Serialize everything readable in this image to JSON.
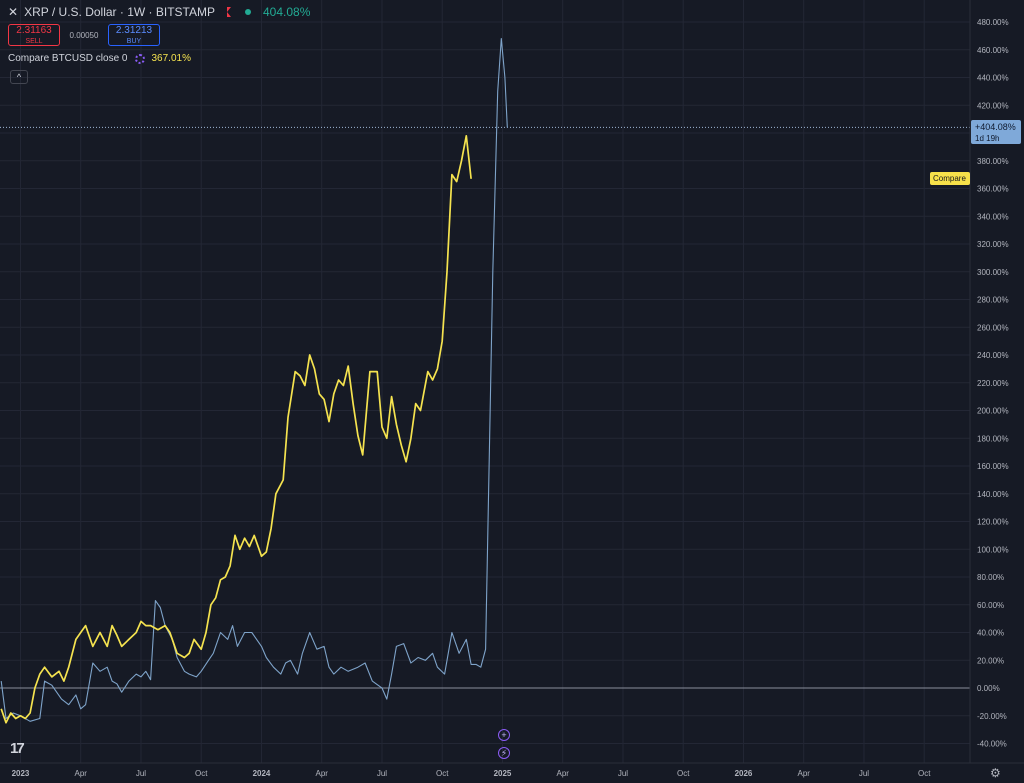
{
  "header": {
    "close_icon": "✕",
    "title": "XRP / U.S. Dollar · 1W · BITSTAMP",
    "change_pct": "404.08%"
  },
  "quote": {
    "sell_price": "2.31163",
    "sell_label": "SELL",
    "spread": "0.00050",
    "buy_price": "2.31213",
    "buy_label": "BUY"
  },
  "compare": {
    "label": "Compare BTCUSD close 0",
    "pct": "367.01%"
  },
  "price_tag": {
    "line1": "+404.08%",
    "line2": "1d 19h"
  },
  "compare_tag": "Compare",
  "logo_text": "17",
  "icons": {
    "plus": "+",
    "bolt": "⚡",
    "settings": "⚙",
    "collapse": "^"
  },
  "colors": {
    "background": "#161a25",
    "grid": "#232735",
    "xrp": "#7ea3c9",
    "btc": "#f5e34f",
    "xrp_tag": "#7fa9d9",
    "btc_tag": "#f7e14a"
  },
  "chart_data": {
    "type": "line",
    "yaxis_ticks": [
      480,
      460,
      440,
      420,
      400,
      380,
      360,
      340,
      320,
      300,
      280,
      260,
      240,
      220,
      200,
      180,
      160,
      140,
      120,
      100,
      80,
      60,
      40,
      20,
      0,
      -20,
      -40
    ],
    "tick_suffix": "%",
    "ylim": [
      -50,
      490
    ],
    "xaxis_labels": [
      {
        "label": "2023",
        "t": 2023.0,
        "bold": true
      },
      {
        "label": "Apr",
        "t": 2023.25
      },
      {
        "label": "Jul",
        "t": 2023.5
      },
      {
        "label": "Oct",
        "t": 2023.75
      },
      {
        "label": "2024",
        "t": 2024.0,
        "bold": true
      },
      {
        "label": "Apr",
        "t": 2024.25
      },
      {
        "label": "Jul",
        "t": 2024.5
      },
      {
        "label": "Oct",
        "t": 2024.75
      },
      {
        "label": "2025",
        "t": 2025.0,
        "bold": true
      },
      {
        "label": "Apr",
        "t": 2025.25
      },
      {
        "label": "Jul",
        "t": 2025.5
      },
      {
        "label": "Oct",
        "t": 2025.75
      },
      {
        "label": "2026",
        "t": 2026.0,
        "bold": true
      },
      {
        "label": "Apr",
        "t": 2026.25
      },
      {
        "label": "Jul",
        "t": 2026.5
      },
      {
        "label": "Oct",
        "t": 2026.75
      }
    ],
    "xlim": [
      2022.915,
      2026.94
    ],
    "series": [
      {
        "name": "XRP / U.S. Dollar",
        "color": "#7ea3c9",
        "points": [
          [
            2022.92,
            5
          ],
          [
            2022.94,
            -22
          ],
          [
            2022.97,
            -18
          ],
          [
            2023.0,
            -20
          ],
          [
            2023.04,
            -24
          ],
          [
            2023.08,
            -22
          ],
          [
            2023.1,
            5
          ],
          [
            2023.13,
            2
          ],
          [
            2023.17,
            -8
          ],
          [
            2023.2,
            -12
          ],
          [
            2023.23,
            -5
          ],
          [
            2023.25,
            -15
          ],
          [
            2023.27,
            -12
          ],
          [
            2023.3,
            18
          ],
          [
            2023.33,
            12
          ],
          [
            2023.36,
            15
          ],
          [
            2023.38,
            5
          ],
          [
            2023.4,
            3
          ],
          [
            2023.42,
            -3
          ],
          [
            2023.45,
            5
          ],
          [
            2023.48,
            10
          ],
          [
            2023.5,
            8
          ],
          [
            2023.52,
            12
          ],
          [
            2023.54,
            6
          ],
          [
            2023.56,
            63
          ],
          [
            2023.58,
            58
          ],
          [
            2023.6,
            45
          ],
          [
            2023.63,
            35
          ],
          [
            2023.65,
            22
          ],
          [
            2023.68,
            12
          ],
          [
            2023.7,
            10
          ],
          [
            2023.73,
            8
          ],
          [
            2023.75,
            12
          ],
          [
            2023.78,
            20
          ],
          [
            2023.8,
            25
          ],
          [
            2023.83,
            40
          ],
          [
            2023.86,
            35
          ],
          [
            2023.88,
            45
          ],
          [
            2023.9,
            30
          ],
          [
            2023.93,
            40
          ],
          [
            2023.96,
            40
          ],
          [
            2024.0,
            30
          ],
          [
            2024.02,
            22
          ],
          [
            2024.05,
            15
          ],
          [
            2024.08,
            10
          ],
          [
            2024.1,
            18
          ],
          [
            2024.12,
            20
          ],
          [
            2024.15,
            10
          ],
          [
            2024.17,
            25
          ],
          [
            2024.2,
            40
          ],
          [
            2024.23,
            28
          ],
          [
            2024.26,
            30
          ],
          [
            2024.28,
            15
          ],
          [
            2024.3,
            10
          ],
          [
            2024.33,
            15
          ],
          [
            2024.36,
            12
          ],
          [
            2024.4,
            15
          ],
          [
            2024.43,
            18
          ],
          [
            2024.46,
            5
          ],
          [
            2024.5,
            0
          ],
          [
            2024.52,
            -8
          ],
          [
            2024.54,
            10
          ],
          [
            2024.56,
            30
          ],
          [
            2024.59,
            32
          ],
          [
            2024.62,
            18
          ],
          [
            2024.65,
            22
          ],
          [
            2024.68,
            20
          ],
          [
            2024.71,
            25
          ],
          [
            2024.73,
            15
          ],
          [
            2024.76,
            10
          ],
          [
            2024.79,
            40
          ],
          [
            2024.82,
            25
          ],
          [
            2024.85,
            35
          ],
          [
            2024.87,
            17
          ],
          [
            2024.89,
            17
          ],
          [
            2024.91,
            15
          ],
          [
            2024.93,
            28
          ],
          [
            2024.96,
            300
          ],
          [
            2024.98,
            430
          ],
          [
            2024.995,
            468
          ],
          [
            2025.01,
            440
          ],
          [
            2025.02,
            404
          ]
        ]
      },
      {
        "name": "Compare BTCUSD close 0",
        "color": "#f5e34f",
        "points": [
          [
            2022.92,
            -15
          ],
          [
            2022.94,
            -25
          ],
          [
            2022.96,
            -18
          ],
          [
            2022.98,
            -22
          ],
          [
            2023.0,
            -20
          ],
          [
            2023.02,
            -22
          ],
          [
            2023.04,
            -18
          ],
          [
            2023.06,
            0
          ],
          [
            2023.08,
            10
          ],
          [
            2023.1,
            15
          ],
          [
            2023.13,
            8
          ],
          [
            2023.16,
            12
          ],
          [
            2023.18,
            5
          ],
          [
            2023.2,
            15
          ],
          [
            2023.23,
            35
          ],
          [
            2023.25,
            40
          ],
          [
            2023.27,
            45
          ],
          [
            2023.3,
            30
          ],
          [
            2023.33,
            40
          ],
          [
            2023.36,
            30
          ],
          [
            2023.38,
            45
          ],
          [
            2023.4,
            38
          ],
          [
            2023.42,
            30
          ],
          [
            2023.45,
            35
          ],
          [
            2023.48,
            40
          ],
          [
            2023.5,
            48
          ],
          [
            2023.52,
            45
          ],
          [
            2023.54,
            45
          ],
          [
            2023.57,
            42
          ],
          [
            2023.6,
            45
          ],
          [
            2023.62,
            40
          ],
          [
            2023.65,
            25
          ],
          [
            2023.68,
            22
          ],
          [
            2023.7,
            25
          ],
          [
            2023.72,
            35
          ],
          [
            2023.75,
            28
          ],
          [
            2023.77,
            40
          ],
          [
            2023.79,
            60
          ],
          [
            2023.81,
            65
          ],
          [
            2023.83,
            78
          ],
          [
            2023.85,
            80
          ],
          [
            2023.87,
            88
          ],
          [
            2023.89,
            110
          ],
          [
            2023.91,
            100
          ],
          [
            2023.93,
            108
          ],
          [
            2023.95,
            102
          ],
          [
            2023.97,
            110
          ],
          [
            2024.0,
            95
          ],
          [
            2024.02,
            98
          ],
          [
            2024.04,
            115
          ],
          [
            2024.06,
            140
          ],
          [
            2024.09,
            150
          ],
          [
            2024.11,
            195
          ],
          [
            2024.14,
            228
          ],
          [
            2024.16,
            225
          ],
          [
            2024.18,
            218
          ],
          [
            2024.2,
            240
          ],
          [
            2024.22,
            230
          ],
          [
            2024.24,
            212
          ],
          [
            2024.26,
            208
          ],
          [
            2024.28,
            192
          ],
          [
            2024.3,
            212
          ],
          [
            2024.32,
            222
          ],
          [
            2024.34,
            218
          ],
          [
            2024.36,
            232
          ],
          [
            2024.38,
            205
          ],
          [
            2024.4,
            182
          ],
          [
            2024.42,
            168
          ],
          [
            2024.45,
            228
          ],
          [
            2024.48,
            228
          ],
          [
            2024.5,
            188
          ],
          [
            2024.52,
            180
          ],
          [
            2024.54,
            210
          ],
          [
            2024.56,
            190
          ],
          [
            2024.58,
            175
          ],
          [
            2024.6,
            163
          ],
          [
            2024.62,
            180
          ],
          [
            2024.64,
            205
          ],
          [
            2024.66,
            200
          ],
          [
            2024.69,
            228
          ],
          [
            2024.71,
            222
          ],
          [
            2024.73,
            230
          ],
          [
            2024.75,
            250
          ],
          [
            2024.77,
            300
          ],
          [
            2024.79,
            370
          ],
          [
            2024.81,
            365
          ],
          [
            2024.83,
            380
          ],
          [
            2024.85,
            398
          ],
          [
            2024.87,
            367
          ]
        ]
      }
    ],
    "last_value": 404.08,
    "compare_value": 367.01
  }
}
